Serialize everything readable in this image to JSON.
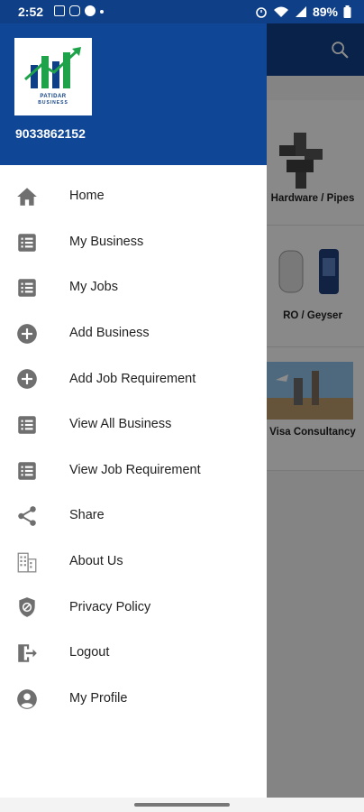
{
  "status_bar": {
    "time": "2:52",
    "battery": "89%"
  },
  "drawer": {
    "brand_line1": "PATIDAR",
    "brand_line2": "BUSINESS",
    "phone": "9033862152",
    "items": [
      {
        "label": "Home",
        "icon": "home-icon"
      },
      {
        "label": "My Business",
        "icon": "list-icon"
      },
      {
        "label": "My Jobs",
        "icon": "list-icon"
      },
      {
        "label": "Add Business",
        "icon": "add-circle-icon"
      },
      {
        "label": "Add Job Requirement",
        "icon": "add-circle-icon"
      },
      {
        "label": "View All Business",
        "icon": "list-icon"
      },
      {
        "label": "View Job Requirement",
        "icon": "list-icon"
      },
      {
        "label": "Share",
        "icon": "share-icon"
      },
      {
        "label": "About Us",
        "icon": "building-icon"
      },
      {
        "label": "Privacy Policy",
        "icon": "shield-icon"
      },
      {
        "label": "Logout",
        "icon": "logout-icon"
      },
      {
        "label": "My Profile",
        "icon": "account-icon"
      }
    ]
  },
  "background": {
    "categories": [
      {
        "label": "Hardware / Pipes"
      },
      {
        "label": "RO / Geyser"
      },
      {
        "label": "Visa Consultancy"
      }
    ]
  },
  "colors": {
    "header_blue": "#0f4696",
    "icon_gray": "#6f6f6f"
  }
}
